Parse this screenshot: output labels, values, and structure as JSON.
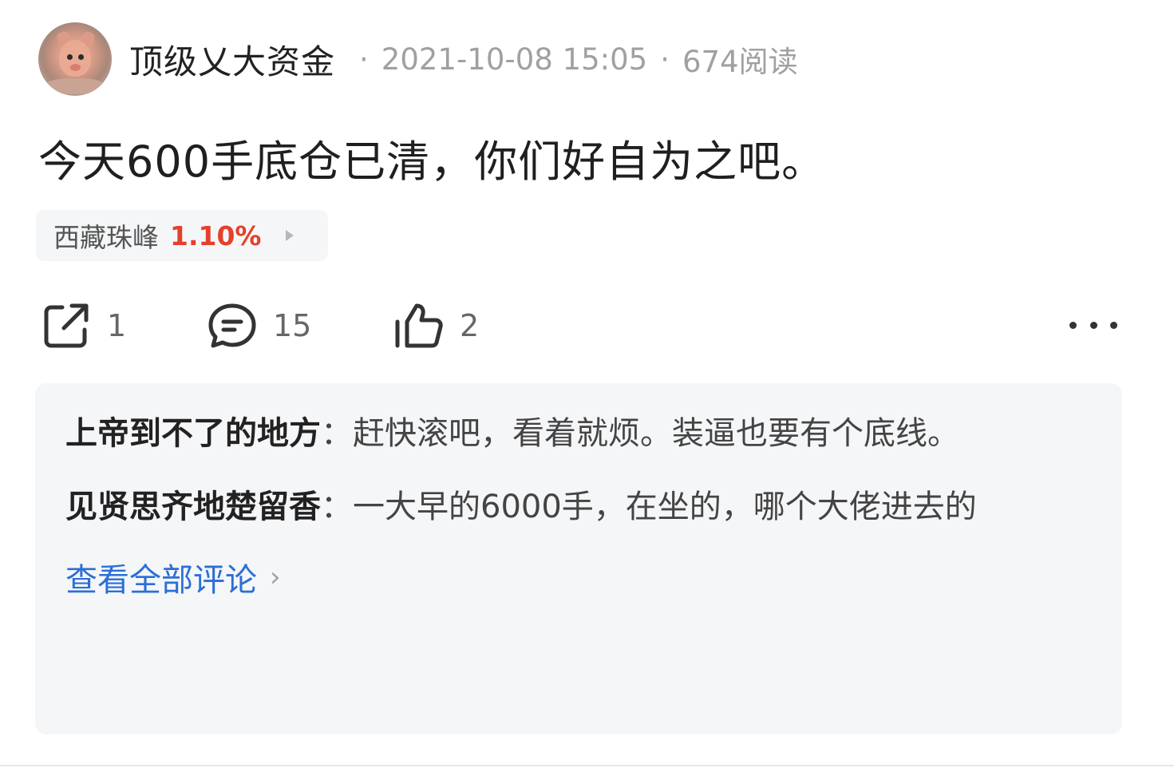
{
  "post": {
    "author": "顶级乂大资金",
    "separator": "·",
    "timestamp": "2021-10-08 15:05",
    "read_count": "674阅读",
    "content": "今天600手底仓已清，你们好自为之吧。",
    "stock_tag": {
      "name": "西藏珠峰",
      "change": "1.10%",
      "change_color": "#e5402b"
    }
  },
  "actions": {
    "share": {
      "icon": "share-icon",
      "count": "1"
    },
    "comment": {
      "icon": "comment-icon",
      "count": "15"
    },
    "like": {
      "icon": "thumbs-up-icon",
      "count": "2"
    },
    "more": {
      "icon": "more-icon"
    }
  },
  "comments": [
    {
      "author": "上帝到不了的地方",
      "separator": "：",
      "text": "赶快滚吧，看着就烦。装逼也要有个底线。"
    },
    {
      "author": "见贤思齐地楚留香",
      "separator": "：",
      "text": "一大早的6000手，在坐的，哪个大佬进去的"
    }
  ],
  "view_all_label": "查看全部评论",
  "colors": {
    "accent_blue": "#2a6fd6",
    "rise_red": "#e5402b",
    "panel_bg": "#f5f6f8"
  }
}
